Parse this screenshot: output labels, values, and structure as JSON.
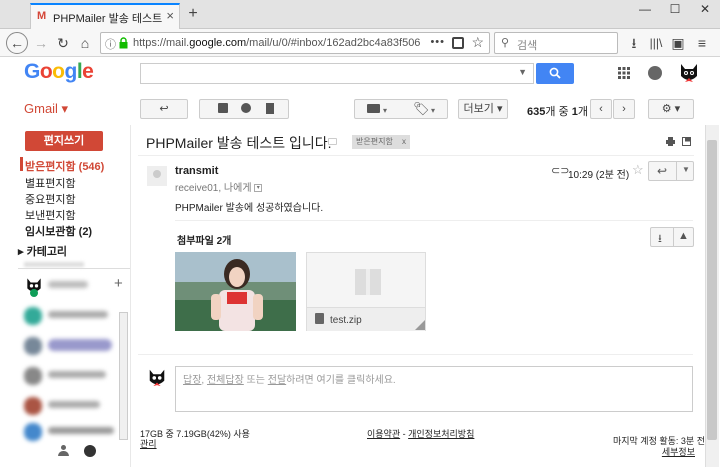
{
  "browser": {
    "tab_title": "PHPMailer 발송 테스트 입니다",
    "tab_favicon": "M",
    "url_prefix": "https://mail.",
    "url_domain": "google.com",
    "url_rest": "/mail/u/0/#inbox/162ad2bc4a83f506",
    "search_placeholder": "검색",
    "accent": "#0a84ff"
  },
  "gmail": {
    "logo_letters": [
      "G",
      "o",
      "o",
      "g",
      "l",
      "e"
    ],
    "logo_colors": [
      "#4285f4",
      "#ea4335",
      "#fbbc05",
      "#4285f4",
      "#34a853",
      "#ea4335"
    ],
    "app_label": "Gmail ▾",
    "toolbar": {
      "more_label": "더보기 ▾",
      "count_bold": "635",
      "count_mid": "개 중 ",
      "count_bold2": "1",
      "count_end": "개"
    },
    "sidebar": {
      "compose_label": "편지쓰기",
      "inbox_label": "받은편지함 (546)",
      "folders": [
        "별표편지함",
        "중요편지함",
        "보낸편지함"
      ],
      "drafts_label": "임시보관함 (2)",
      "category_label": "▸ 카테고리",
      "hangouts_add": "+"
    },
    "message": {
      "subject": "PHPMailer 발송 테스트 입니다.",
      "label_chip": "받은편지함",
      "label_chip_x": "x",
      "sender": "transmit",
      "receiver": "receive01, 나에게",
      "time": "10:29 (2분 전)",
      "body": "PHPMailer 발송에 성공하였습니다.",
      "attachments_title": "첨부파일 2개",
      "zip_name": "test.zip"
    },
    "reply": {
      "link1": "답장",
      "sep1": ", ",
      "link2": "전체답장",
      "mid": " 또는 ",
      "link3": "전달",
      "end": "하려면 여기를 클릭하세요."
    },
    "footer": {
      "storage": "17GB 중 7.19GB(42%) 사용",
      "manage": "관리",
      "terms": "이용약관",
      "terms_sep": " - ",
      "privacy": "개인정보처리방침",
      "last_activity": "마지막 계정 활동: 3분 전",
      "details": "세부정보"
    },
    "colors": {
      "brand_red": "#d14836",
      "search_blue": "#4285f4"
    }
  }
}
